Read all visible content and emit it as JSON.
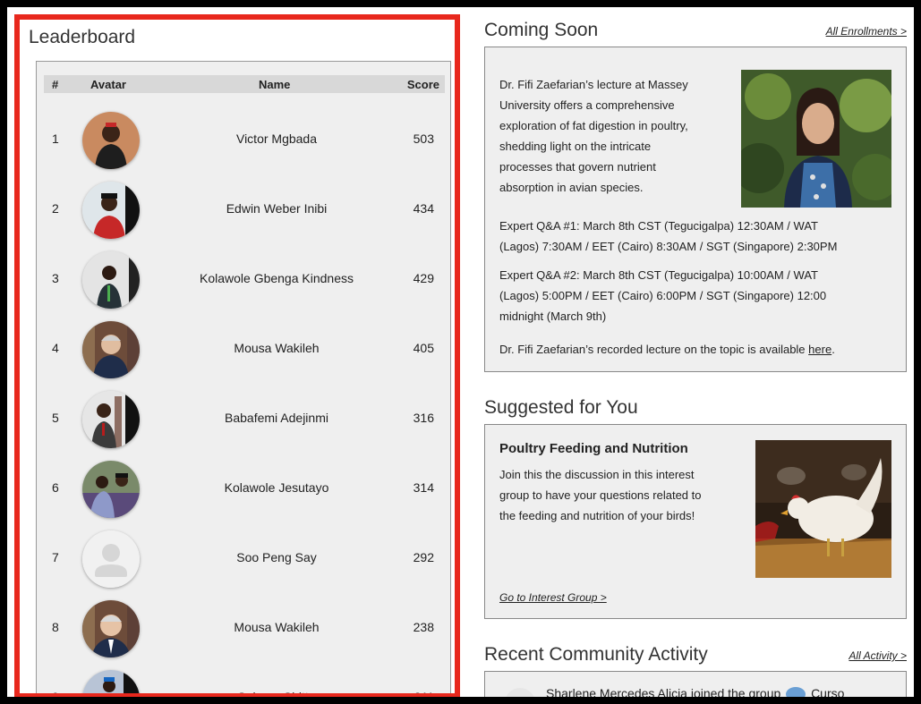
{
  "leaderboard": {
    "title": "Leaderboard",
    "columns": {
      "rank": "#",
      "avatar": "Avatar",
      "name": "Name",
      "score": "Score"
    },
    "rows": [
      {
        "rank": "1",
        "name": "Victor Mgbada",
        "score": "503"
      },
      {
        "rank": "2",
        "name": "Edwin Weber Inibi",
        "score": "434"
      },
      {
        "rank": "3",
        "name": "Kolawole Gbenga Kindness",
        "score": "429"
      },
      {
        "rank": "4",
        "name": "Mousa Wakileh",
        "score": "405"
      },
      {
        "rank": "5",
        "name": "Babafemi Adejinmi",
        "score": "316"
      },
      {
        "rank": "6",
        "name": "Kolawole Jesutayo",
        "score": "314"
      },
      {
        "rank": "7",
        "name": "Soo Peng Say",
        "score": "292"
      },
      {
        "rank": "8",
        "name": "Mousa Wakileh",
        "score": "238"
      },
      {
        "rank": "9",
        "name": "Seleem Shittu",
        "score": "211"
      }
    ]
  },
  "coming_soon": {
    "title": "Coming Soon",
    "link": "All Enrollments >",
    "description_lines": [
      "Dr. Fifi Zaefarian’s lecture at Massey",
      "University offers a comprehensive",
      "exploration of fat digestion in poultry,",
      "shedding light on the intricate",
      "processes that govern nutrient",
      "absorption in avian species."
    ],
    "qa1_lines": [
      "Expert Q&A #1: March 8th CST (Tegucigalpa) 12:30AM / WAT",
      "(Lagos) 7:30AM / EET (Cairo) 8:30AM / SGT (Singapore) 2:30PM"
    ],
    "qa2_lines": [
      "Expert Q&A #2: March 8th CST (Tegucigalpa) 10:00AM / WAT",
      "(Lagos) 5:00PM / EET (Cairo) 6:00PM / SGT (Singapore) 12:00",
      "midnight (March 9th)"
    ],
    "recorded_prefix": "Dr. Fifi Zaefarian’s recorded lecture on the topic is available ",
    "recorded_link": "here",
    "recorded_suffix": "."
  },
  "suggested": {
    "title": "Suggested for You",
    "card_title": "Poultry Feeding and Nutrition",
    "description_lines": [
      "Join this the discussion in this interest",
      "group to have your questions related to",
      "the feeding and nutrition of your birds!"
    ],
    "link": "Go to Interest Group >"
  },
  "recent": {
    "title": "Recent Community Activity",
    "link": "All Activity >",
    "activity_prefix": "Sharlene Mercedes Alicia joined the group",
    "activity_suffix": "Curso"
  }
}
